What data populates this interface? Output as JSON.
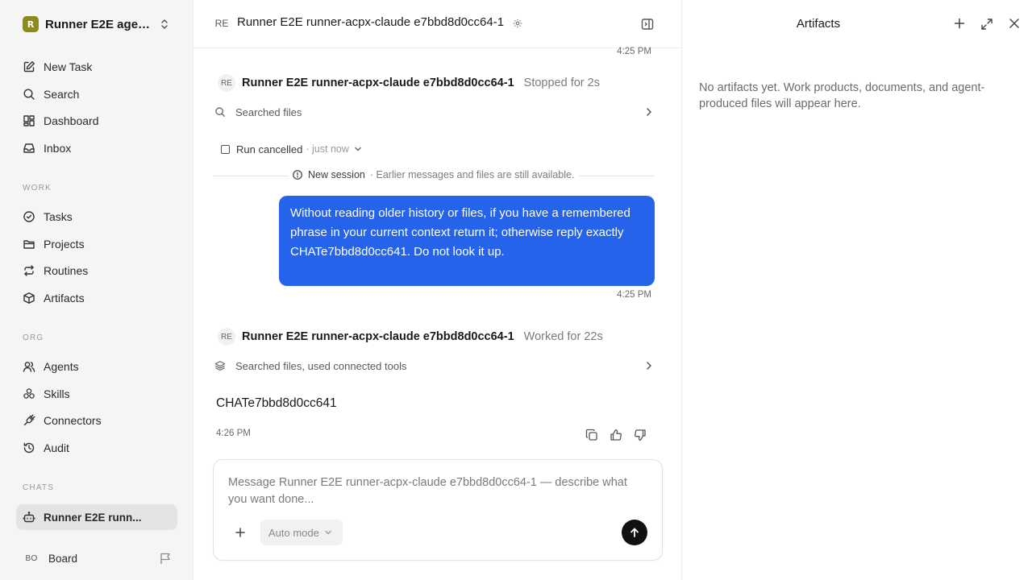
{
  "sidebar": {
    "workspace": {
      "logo": "R",
      "name": "Runner E2E agen..."
    },
    "nav_top": [
      {
        "label": "New Task",
        "icon": "edit-icon"
      },
      {
        "label": "Search",
        "icon": "search-icon"
      },
      {
        "label": "Dashboard",
        "icon": "dashboard-icon"
      },
      {
        "label": "Inbox",
        "icon": "inbox-icon"
      }
    ],
    "sections": {
      "work": "WORK",
      "org": "ORG",
      "chats": "CHATS"
    },
    "nav_work": [
      {
        "label": "Tasks",
        "icon": "check-circle-icon"
      },
      {
        "label": "Projects",
        "icon": "folder-icon"
      },
      {
        "label": "Routines",
        "icon": "repeat-icon"
      },
      {
        "label": "Artifacts",
        "icon": "box-icon"
      }
    ],
    "nav_org": [
      {
        "label": "Agents",
        "icon": "users-icon"
      },
      {
        "label": "Skills",
        "icon": "skills-icon"
      },
      {
        "label": "Connectors",
        "icon": "plug-icon"
      },
      {
        "label": "Audit",
        "icon": "history-icon"
      }
    ],
    "chats": [
      {
        "label": "Runner E2E runn...",
        "icon": "bot-icon",
        "active": true
      }
    ],
    "user": {
      "initials": "BO",
      "name": "Board"
    }
  },
  "chat": {
    "header": {
      "avatar": "RE",
      "title": "Runner E2E runner-acpx-claude e7bbd8d0cc64-1"
    },
    "messages": {
      "ts_top": "4:25 PM",
      "agent1": {
        "avatar": "RE",
        "name": "Runner E2E runner-acpx-claude e7bbd8d0cc64-1",
        "status": "Stopped for 2s",
        "tool": "Searched files"
      },
      "cancel": {
        "label": "Run cancelled",
        "time": "· just now"
      },
      "session": {
        "label": "New session",
        "note": "· Earlier messages and files are still available."
      },
      "user_message": "Without reading older history or files, if you have a remembered phrase in your current context return it; otherwise reply exactly CHATe7bbd8d0cc641. Do not look it up.",
      "user_ts": "4:25 PM",
      "agent2": {
        "avatar": "RE",
        "name": "Runner E2E runner-acpx-claude e7bbd8d0cc64-1",
        "status": "Worked for 22s",
        "tool": "Searched files, used connected tools",
        "answer": "CHATe7bbd8d0cc641",
        "ts": "4:26 PM"
      }
    },
    "composer": {
      "placeholder": "Message Runner E2E runner-acpx-claude e7bbd8d0cc64-1 — describe what you want done...",
      "value": "",
      "mode": "Auto mode"
    }
  },
  "artifacts": {
    "title": "Artifacts",
    "empty": "No artifacts yet. Work products, documents, and agent-produced files will appear here."
  },
  "colors": {
    "accent": "#2563eb",
    "sidebar_bg": "#f5f5f4",
    "active_item_bg": "#e4e4e2"
  }
}
